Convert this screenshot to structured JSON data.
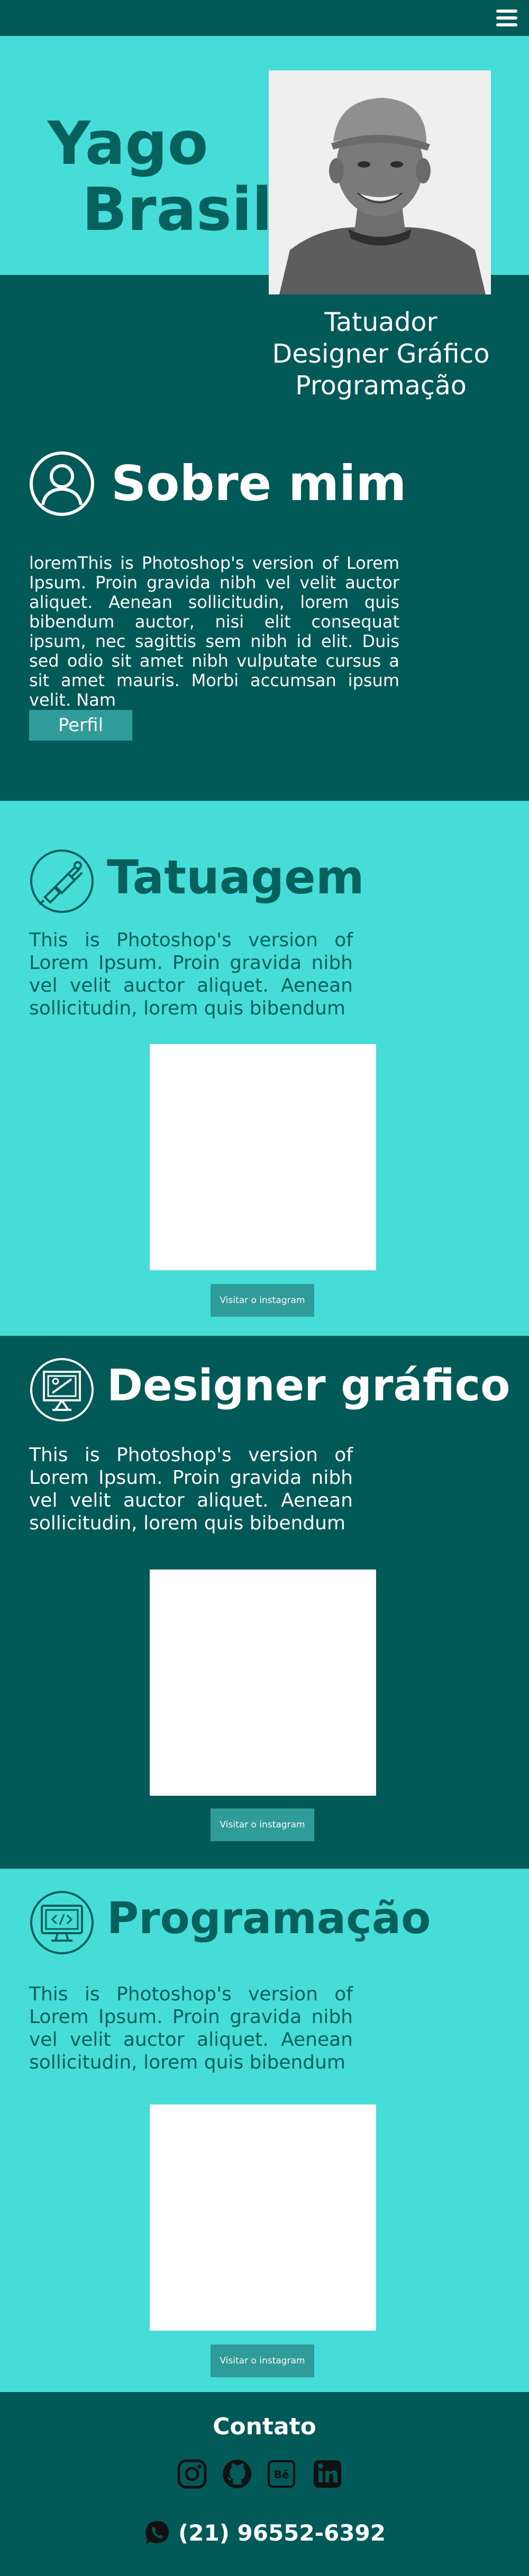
{
  "header": {
    "menu_icon": "hamburger-menu-icon"
  },
  "hero": {
    "first_name": "Yago",
    "last_name": "Brasil",
    "roles": [
      "Tatuador",
      "Designer Gráfico",
      "Programação"
    ]
  },
  "about": {
    "icon": "user-icon",
    "title": "Sobre mim",
    "text": "loremThis is Photoshop's version  of Lorem Ipsum. Proin gravida nibh vel velit auctor aliquet. Aenean sollicitudin, lorem quis bibendum auctor, nisi elit consequat ipsum, nec sagittis sem nibh id elit. Duis sed odio sit amet nibh vulputate cursus a sit amet mauris. Morbi accumsan ipsum velit. Nam",
    "button": "Perfil"
  },
  "sections": [
    {
      "icon": "tattoo-machine-icon",
      "title": "Tatuagem",
      "text": "This is Photoshop's version  of Lorem Ipsum. Proin gravida nibh vel velit auctor aliquet. Aenean sollicitudin, lorem quis bibendum",
      "button": "Visitar o instagram"
    },
    {
      "icon": "graphic-design-icon",
      "title": "Designer gráfico",
      "text": "This is Photoshop's version  of Lorem Ipsum. Proin gravida nibh vel velit auctor aliquet. Aenean sollicitudin, lorem quis bibendum",
      "button": "Visitar o instagram"
    },
    {
      "icon": "code-monitor-icon",
      "title": "Programação",
      "text": "This is Photoshop's version  of Lorem Ipsum. Proin gravida nibh vel velit auctor aliquet. Aenean sollicitudin, lorem quis bibendum",
      "button": "Visitar o instagram"
    }
  ],
  "footer": {
    "title": "Contato",
    "social": [
      "instagram-icon",
      "github-icon",
      "behance-icon",
      "linkedin-icon"
    ],
    "phone": "(21) 96552-6392",
    "phone_icon": "whatsapp-icon"
  },
  "colors": {
    "dark_teal": "#015a58",
    "light_teal": "#46dcd8",
    "button_teal": "#2f9c9a",
    "title_dark": "#06605c"
  }
}
